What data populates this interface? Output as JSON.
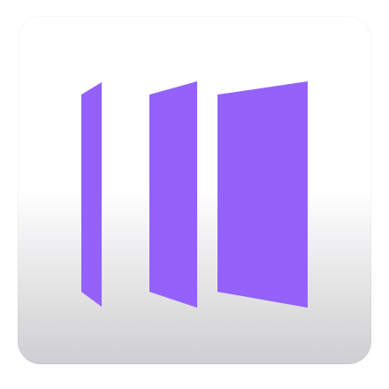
{
  "app_icon": {
    "icon_name": "panels-logo-icon",
    "accent_color": "#9461FA",
    "background_top_color": "#FFFFFF",
    "background_bottom_color": "#CFCED3"
  }
}
